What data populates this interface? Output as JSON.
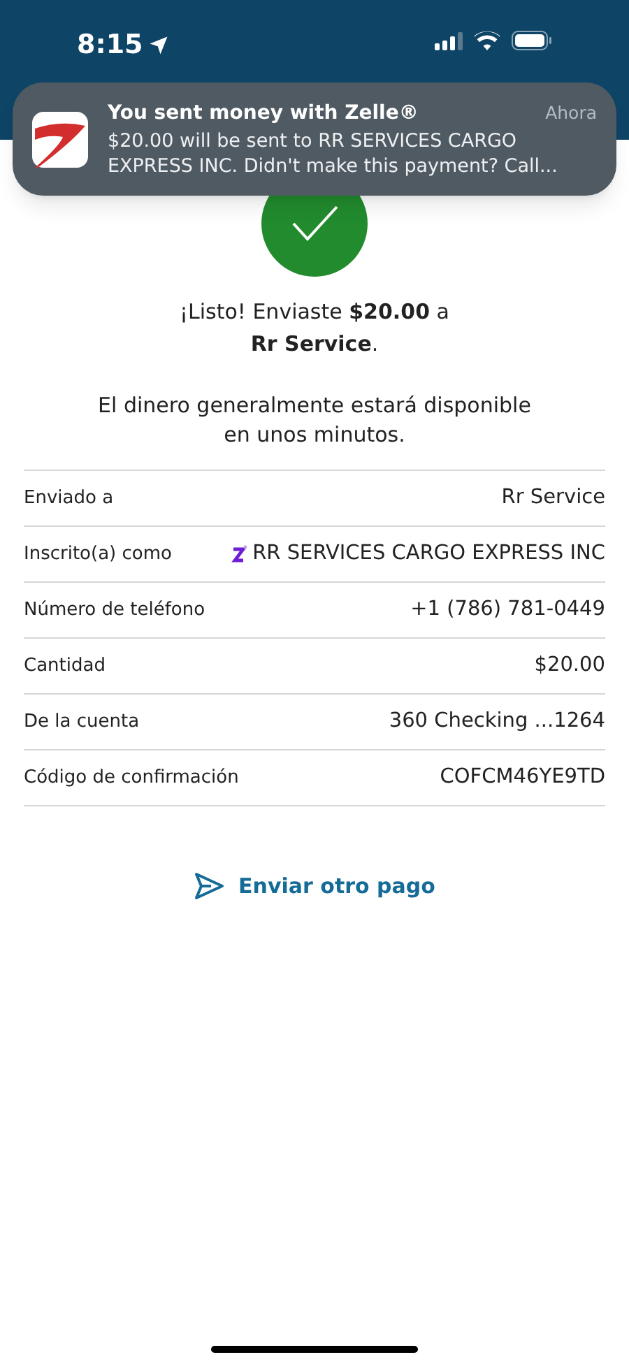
{
  "status_bar": {
    "time": "8:15"
  },
  "notification": {
    "title": "You sent money with Zelle®",
    "time": "Ahora",
    "body": "$20.00 will be sent to RR SERVICES CARGO EXPRESS INC. Didn't make this payment? Call..."
  },
  "confirmation": {
    "message_lines": [
      "¡Listo! Enviaste **$20.00** a",
      "**Rr Service**."
    ],
    "note_lines": [
      "El dinero generalmente estará disponible",
      "en unos minutos."
    ]
  },
  "details": [
    {
      "kind": "plain",
      "label": "Enviado a",
      "value": "Rr Service"
    },
    {
      "kind": "zelle",
      "label": "Inscrito(a) como",
      "value": "RR SERVICES CARGO EXPRESS INC"
    },
    {
      "kind": "plain",
      "label": "Número de teléfono",
      "value": "+1 (786) 781-0449"
    },
    {
      "kind": "plain",
      "label": "Cantidad",
      "value": "$20.00"
    },
    {
      "kind": "plain",
      "label": "De la cuenta",
      "value": "360 Checking ...1264"
    },
    {
      "kind": "plain",
      "label": "Código de confirmación",
      "value": "COFCM46YE9TD"
    }
  ],
  "action": {
    "label": "Enviar otro pago"
  }
}
